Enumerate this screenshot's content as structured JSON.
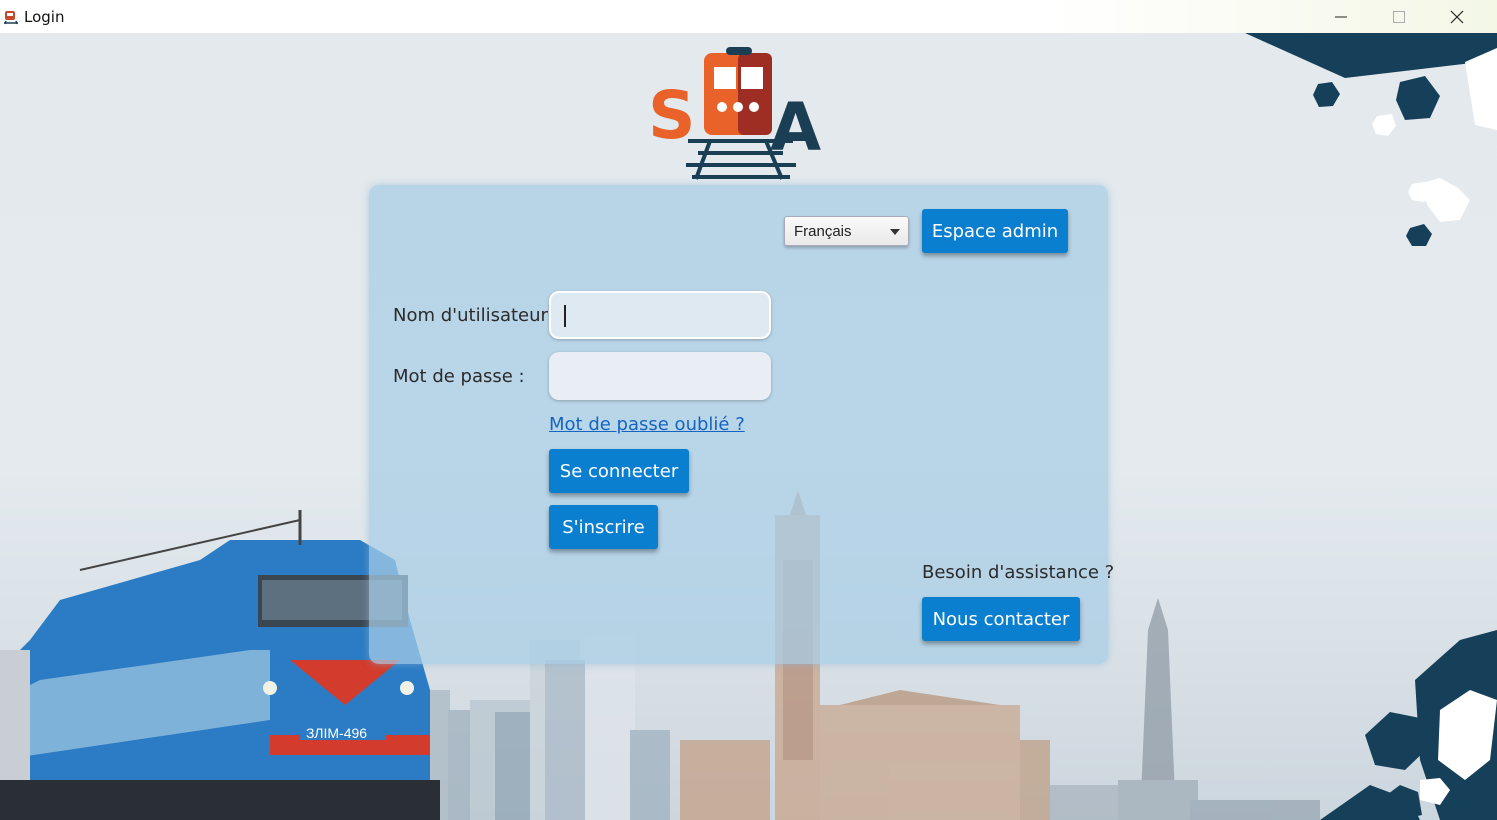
{
  "window": {
    "title": "Login",
    "controls": {
      "minimize": "minimize-icon",
      "maximize": "maximize-icon",
      "close": "close-icon"
    }
  },
  "logo": {
    "letters": "SA",
    "brand_colors": {
      "orange": "#e8622a",
      "navy": "#1a3f55"
    }
  },
  "header": {
    "language": {
      "selected": "Français"
    },
    "admin_button": "Espace admin"
  },
  "form": {
    "username_label": "Nom d'utilisateur :",
    "username_value": "",
    "password_label": "Mot de passe :",
    "password_value": "",
    "forgot_link": "Mot de passe oublié ?",
    "login_button": "Se connecter",
    "signup_button": "S'inscrire"
  },
  "support": {
    "prompt": "Besoin d'assistance ?",
    "contact_button": "Nous contacter"
  },
  "background": {
    "locomotive_plate": "ЗЛIМ-496"
  },
  "colors": {
    "button": "#0a7fd0",
    "panel": "#a8cde6",
    "link": "#1565c0",
    "hex_accent": "#16405a"
  }
}
